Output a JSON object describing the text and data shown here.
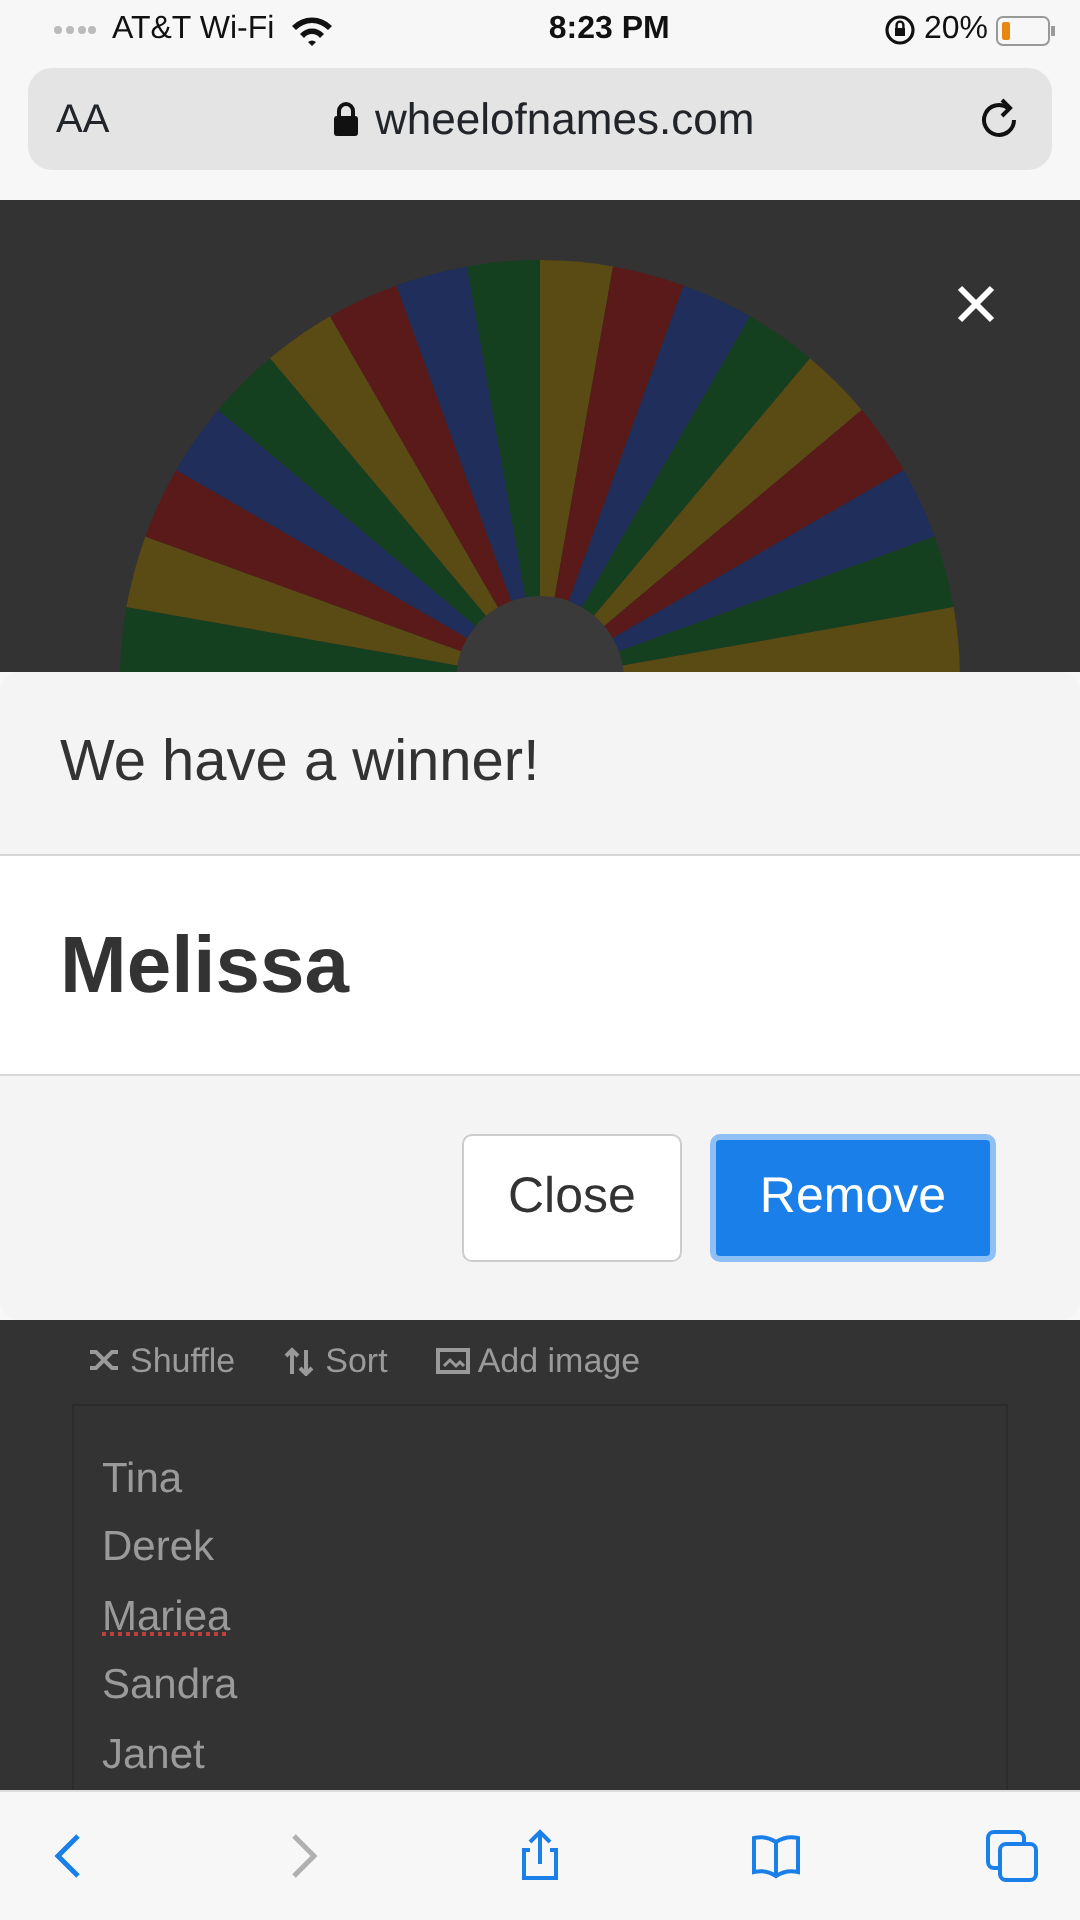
{
  "status_bar": {
    "carrier": "AT&T Wi-Fi",
    "time": "8:23 PM",
    "battery": "20%"
  },
  "address_bar": {
    "text_size": "AA",
    "url": "wheelofnames.com"
  },
  "dialog": {
    "title": "We have a winner!",
    "winner": "Melissa",
    "buttons": [
      {
        "label": "Close",
        "kind": "secondary"
      },
      {
        "label": "Remove",
        "kind": "primary"
      }
    ]
  },
  "toolbar": [
    {
      "label": "Shuffle",
      "kind": "shuffle"
    },
    {
      "label": "Sort",
      "kind": "sort"
    },
    {
      "label": "Add image",
      "kind": "image"
    }
  ],
  "entries": [
    {
      "name": "Tina",
      "misspelled": false
    },
    {
      "name": "Derek",
      "misspelled": false
    },
    {
      "name": "Mariea",
      "misspelled": true
    },
    {
      "name": "Sandra",
      "misspelled": false
    },
    {
      "name": "Janet",
      "misspelled": false
    }
  ],
  "browser_toolbar": [
    {
      "kind": "back",
      "disabled": false
    },
    {
      "kind": "forward",
      "disabled": true
    },
    {
      "kind": "share",
      "disabled": false
    },
    {
      "kind": "bookmarks",
      "disabled": false
    },
    {
      "kind": "tabs",
      "disabled": false
    }
  ]
}
